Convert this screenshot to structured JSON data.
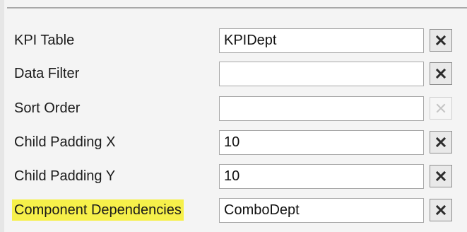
{
  "properties": [
    {
      "label": "KPI Table",
      "value": "KPIDept",
      "highlighted": false,
      "clear_enabled": true
    },
    {
      "label": "Data Filter",
      "value": "",
      "highlighted": false,
      "clear_enabled": true
    },
    {
      "label": "Sort Order",
      "value": "",
      "highlighted": false,
      "clear_enabled": false
    },
    {
      "label": "Child Padding X",
      "value": "10",
      "highlighted": false,
      "clear_enabled": true
    },
    {
      "label": "Child Padding Y",
      "value": "10",
      "highlighted": false,
      "clear_enabled": true
    },
    {
      "label": "Component Dependencies",
      "value": "ComboDept",
      "highlighted": true,
      "clear_enabled": true
    }
  ],
  "icons": {
    "clear": "close-x-icon"
  },
  "colors": {
    "highlight": "#f6f04a",
    "clear_enabled": "#2b2b2b",
    "clear_disabled": "#c4c4c4"
  }
}
